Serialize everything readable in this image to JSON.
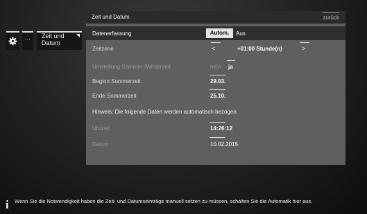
{
  "nav": {
    "more_label": "...",
    "current_label": "Zeit und Datum"
  },
  "panel": {
    "title": "Zeit und Datum",
    "back_label": "zurück"
  },
  "rows": {
    "datenerfassung": {
      "label": "Datenerfassung",
      "option_selected": "Autom.",
      "option_other": "Aus"
    },
    "zeitzone": {
      "label": "Zeitzone",
      "left_arrow": "<",
      "value": "+01:00 Stunde(n)",
      "right_arrow": ">"
    },
    "umstellung": {
      "label": "Umstellung Sommer-/Winterzeit",
      "option_no": "nein",
      "option_yes": "ja"
    },
    "beginn": {
      "label": "Beginn Sommerzeit",
      "value": "29.03."
    },
    "ende": {
      "label": "Ende Sommerzeit",
      "value": "25.10."
    },
    "hinweis": "Hinweis: Die folgende Daten werden automatisch bezogen.",
    "uhrzeit": {
      "label": "Uhrzeit",
      "value": "14:26:12"
    },
    "datum": {
      "label": "Datum",
      "value": "10.02.2015"
    }
  },
  "footer": {
    "icon": "info-icon",
    "text": "Wenn Sie die Notwendigkeit haben die Zeit- und Datumseinträge manuell setzen zu müssen, schalten Sie die Automatik hier aus."
  },
  "colors": {
    "panel_bg": "#5f5f5f",
    "header_bg": "#2b2b2b",
    "highlight_row": "#2f2f2f",
    "selected_button": "#e3e3e3",
    "dimmed_text": "#9a9a9a"
  }
}
